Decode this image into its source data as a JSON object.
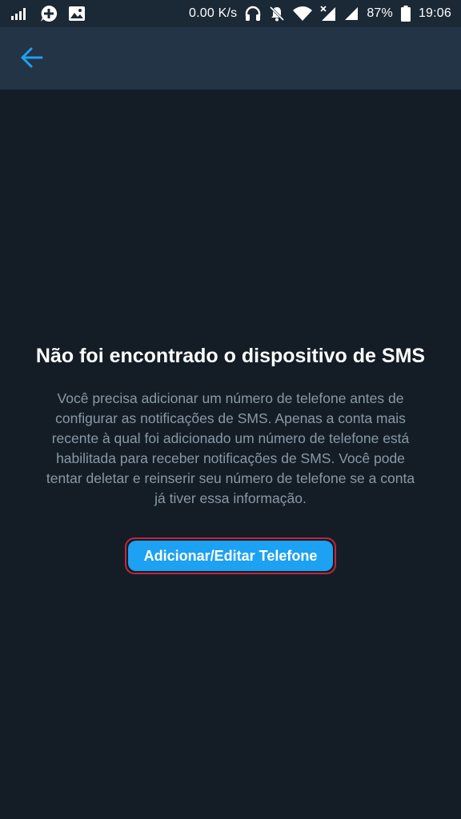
{
  "status_bar": {
    "network_speed": "0.00 K/s",
    "battery": "87%",
    "time": "19:06",
    "icons": [
      "signal-icon",
      "add-chat-icon",
      "image-icon",
      "headphones-icon",
      "notifications-off-icon",
      "wifi-icon",
      "no-signal-icon",
      "cell-signal-icon",
      "battery-icon"
    ]
  },
  "app_bar": {
    "back_icon": "arrow-left-icon",
    "accent": "#1da1f2"
  },
  "empty_state": {
    "title": "Não foi encontrado o dispositivo de SMS",
    "body_lines": [
      "Você precisa adicionar um número de telefone antes de",
      "configurar as notificações de SMS. Apenas a conta mais",
      "recente à qual foi adicionado um número de telefone está",
      "habilitada para receber notificações de SMS. Você pode",
      "tentar deletar e reinserir seu número de telefone se a conta",
      "já tiver essa informação."
    ],
    "button_label": "Adicionar/Editar Telefone"
  },
  "colors": {
    "background": "#141d26",
    "app_bar": "#243447",
    "status_bar": "#1b2836",
    "body_text": "#8899a6",
    "button": "#1da1f2",
    "highlight": "#c4243a"
  }
}
